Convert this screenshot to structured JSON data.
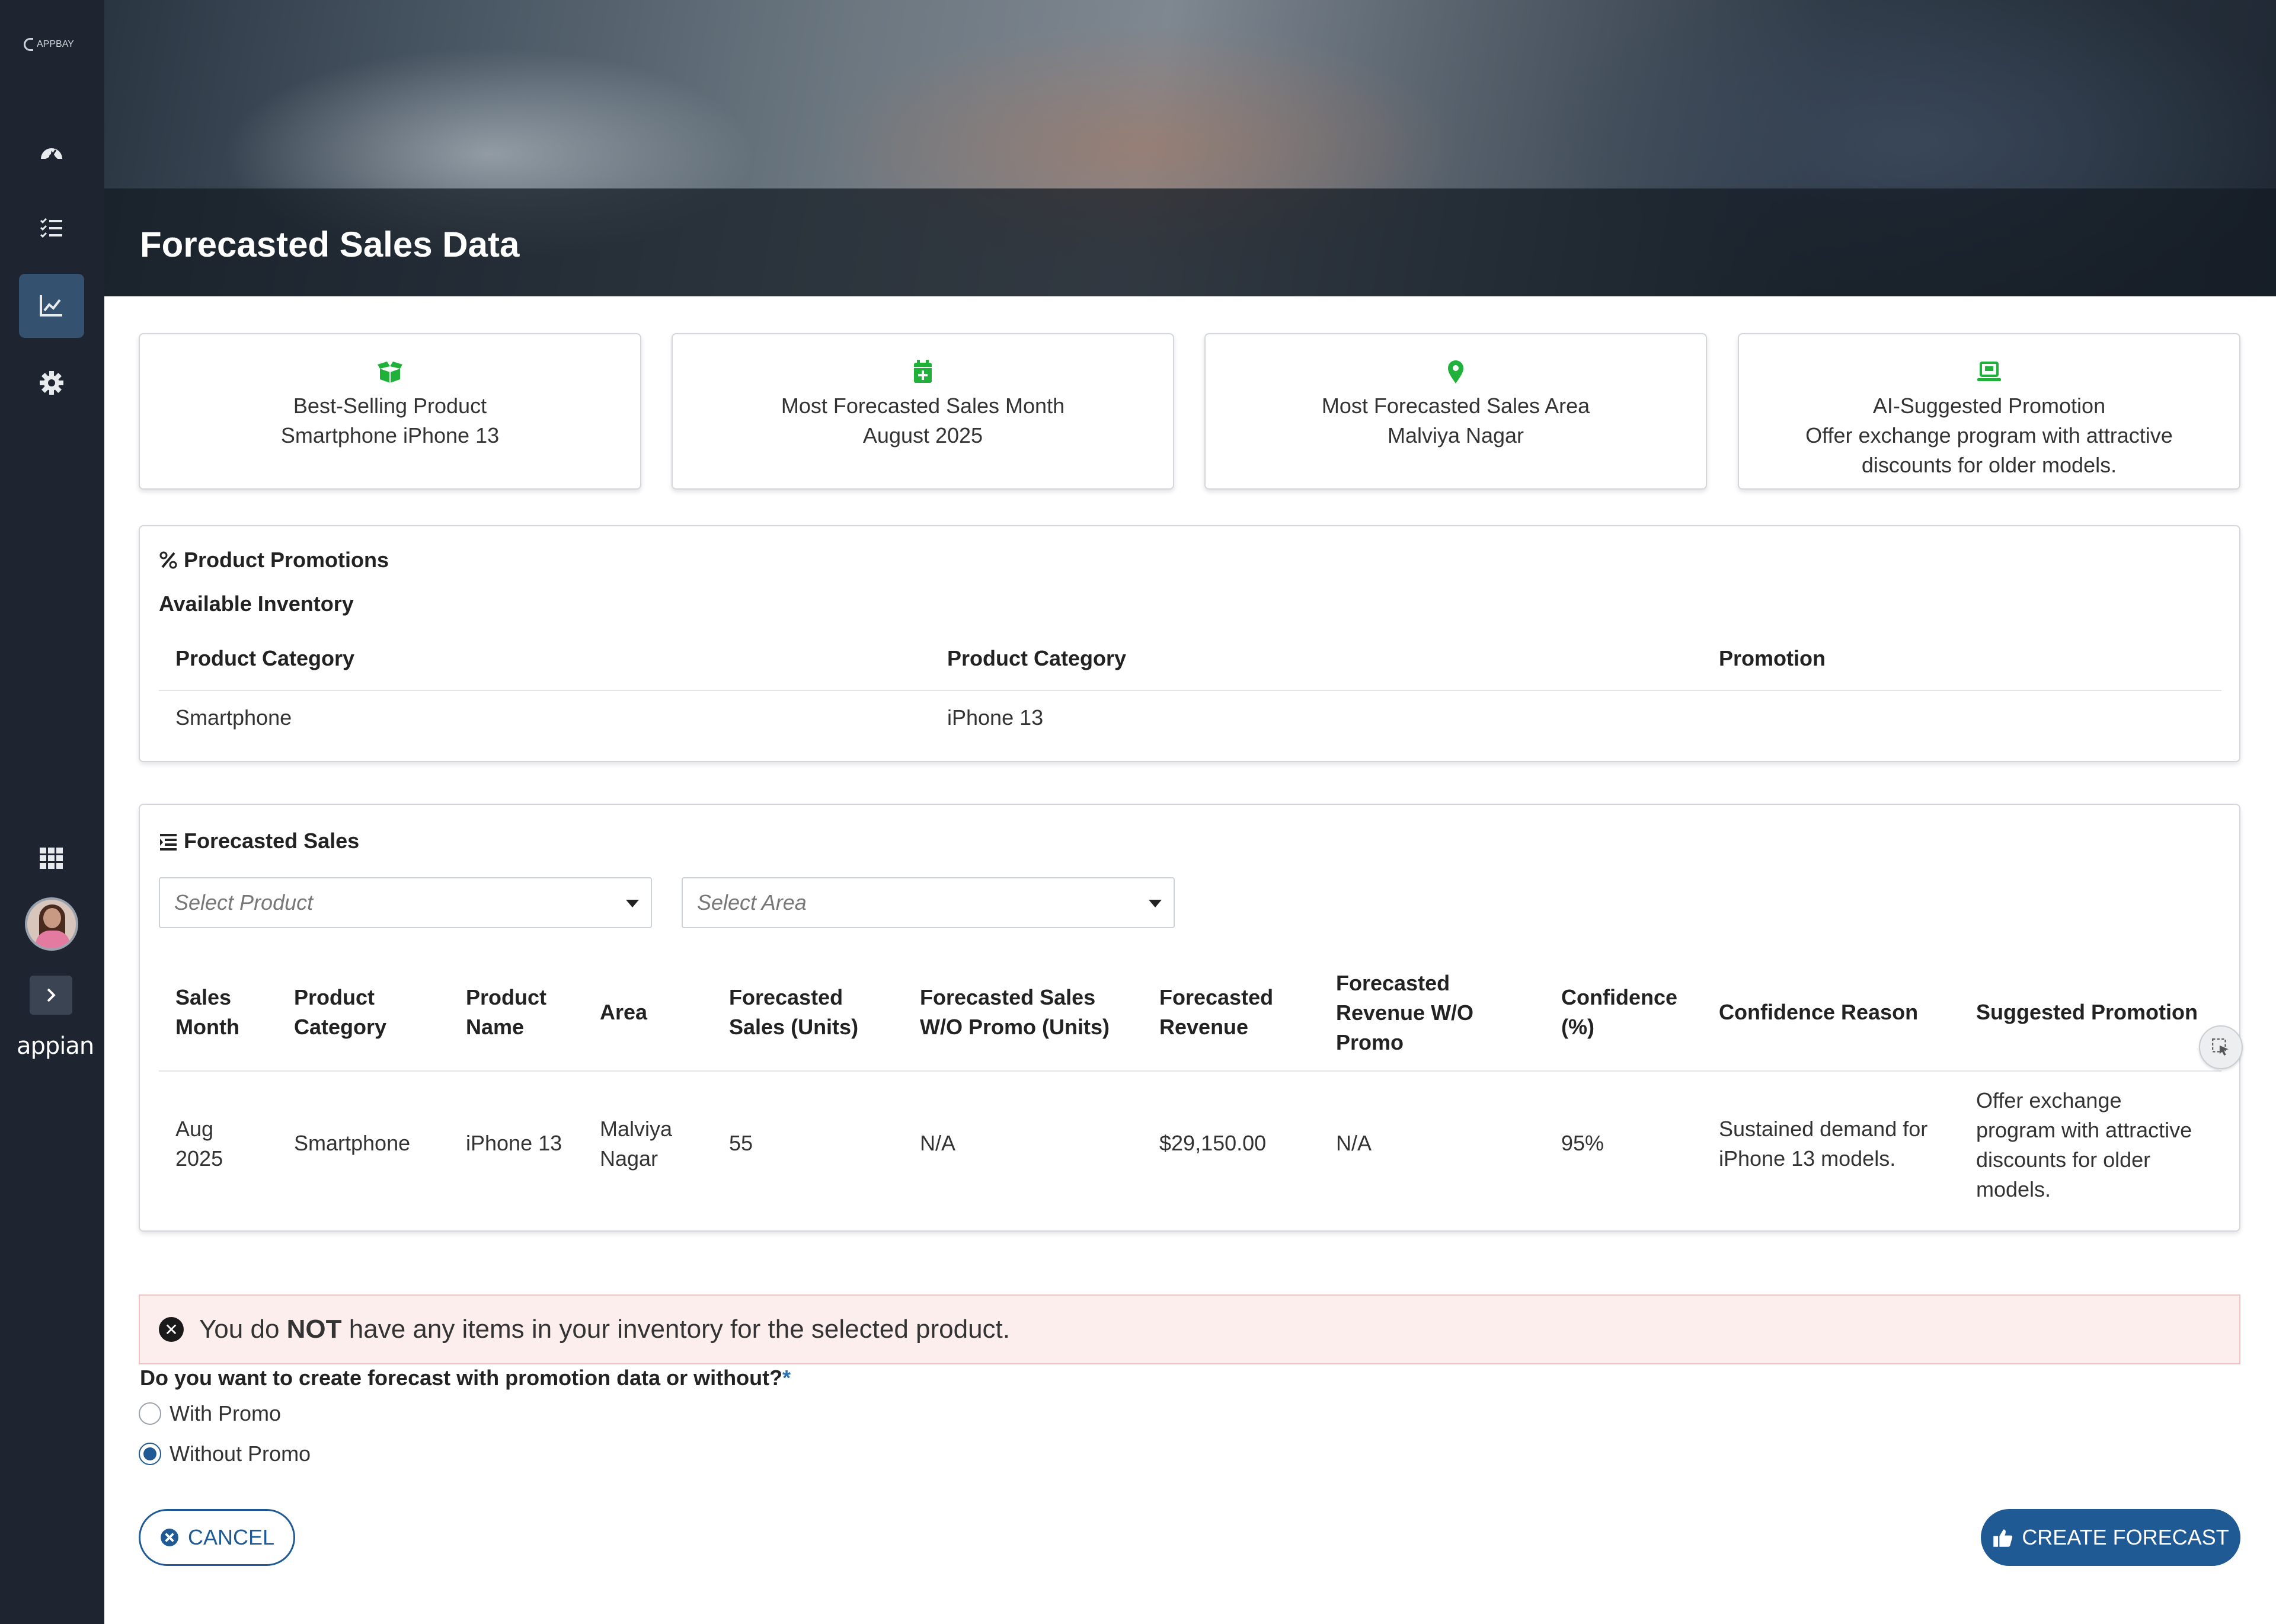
{
  "app": {
    "logo_text": "APPBAY",
    "brand": "appian"
  },
  "banner": {
    "title": "Forecasted Sales Data"
  },
  "colors": {
    "accent": "#1f5a94",
    "sidebar": "#1e2530",
    "icon_green": "#1fb13a",
    "error_bg": "#fdeeee"
  },
  "nav": [
    {
      "icon": "dashboard-icon"
    },
    {
      "icon": "tasks-list-icon"
    },
    {
      "icon": "chart-line-icon",
      "active": true
    },
    {
      "icon": "gear-icon"
    }
  ],
  "cards": [
    {
      "icon": "box-open-icon",
      "label": "Best-Selling Product",
      "value": "Smartphone iPhone 13"
    },
    {
      "icon": "calendar-plus-icon",
      "label": "Most Forecasted Sales Month",
      "value": "August 2025"
    },
    {
      "icon": "map-pin-icon",
      "label": "Most Forecasted Sales Area",
      "value": "Malviya Nagar"
    },
    {
      "icon": "laptop-icon",
      "label": "AI-Suggested Promotion",
      "value_line1": "Offer exchange program with attractive",
      "value_line2": "discounts for older models."
    }
  ],
  "promotions": {
    "title": "Product Promotions",
    "subtitle": "Available Inventory",
    "columns": [
      "Product Category",
      "Product Category",
      "Promotion"
    ],
    "rows": [
      [
        "Smartphone",
        "iPhone 13",
        ""
      ]
    ]
  },
  "forecast": {
    "title": "Forecasted Sales",
    "product_placeholder": "Select Product",
    "area_placeholder": "Select Area",
    "columns": [
      [
        "Sales",
        "Month"
      ],
      [
        "Product",
        "Category"
      ],
      [
        "Product",
        "Name"
      ],
      [
        "Area"
      ],
      [
        "Forecasted",
        "Sales (Units)"
      ],
      [
        "Forecasted Sales",
        "W/O Promo (Units)"
      ],
      [
        "Forecasted",
        "Revenue"
      ],
      [
        "Forecasted",
        "Revenue W/O",
        "Promo"
      ],
      [
        "Confidence",
        "(%)"
      ],
      [
        "Confidence Reason"
      ],
      [
        "Suggested Promotion"
      ]
    ],
    "row": {
      "sales_month": [
        "Aug",
        "2025"
      ],
      "category": "Smartphone",
      "name": "iPhone 13",
      "area": [
        "Malviya",
        "Nagar"
      ],
      "units": "55",
      "units_wo": "N/A",
      "revenue": "$29,150.00",
      "revenue_wo": "N/A",
      "confidence": "95%",
      "reason": [
        "Sustained demand for",
        "iPhone 13 models."
      ],
      "promotion": [
        "Offer exchange",
        "program with attractive",
        "discounts for older",
        "models."
      ]
    }
  },
  "error": {
    "pre": "You do ",
    "bold": "NOT",
    "post": " have any items in your inventory for the selected product."
  },
  "question": {
    "text": "Do you want to create forecast with promotion data or without?",
    "required_mark": "*",
    "options": [
      "With Promo",
      "Without Promo"
    ],
    "selected": "Without Promo"
  },
  "actions": {
    "cancel": "CANCEL",
    "create": "CREATE FORECAST"
  }
}
